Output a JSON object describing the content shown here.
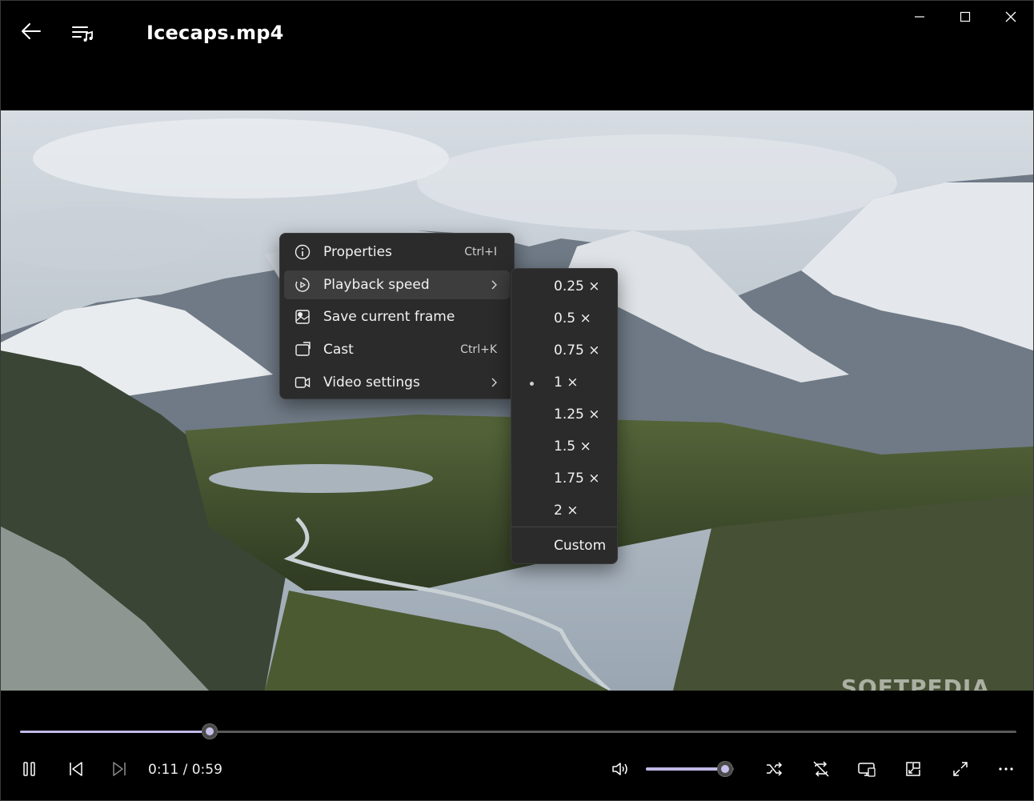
{
  "window": {
    "title": "Icecaps.mp4"
  },
  "titlebar": {
    "back_icon": "back-arrow-icon",
    "playlist_icon": "playlist-icon",
    "minimize_icon": "minimize-icon",
    "maximize_icon": "maximize-icon",
    "close_icon": "close-icon"
  },
  "video": {
    "watermark": "SOFTPEDIA"
  },
  "context_menu": {
    "items": [
      {
        "label": "Properties",
        "shortcut": "Ctrl+I",
        "icon": "info-icon"
      },
      {
        "label": "Playback speed",
        "shortcut": "",
        "icon": "playback-speed-icon",
        "submenu": true
      },
      {
        "label": "Save current frame",
        "shortcut": "",
        "icon": "save-frame-icon"
      },
      {
        "label": "Cast",
        "shortcut": "Ctrl+K",
        "icon": "cast-icon"
      },
      {
        "label": "Video settings",
        "shortcut": "",
        "icon": "video-settings-icon",
        "submenu": true
      }
    ]
  },
  "speed_menu": {
    "options": [
      "0.25 ×",
      "0.5 ×",
      "0.75 ×",
      "1 ×",
      "1.25 ×",
      "1.5 ×",
      "1.75 ×",
      "2 ×"
    ],
    "selected": "1 ×",
    "custom_label": "Custom"
  },
  "playback": {
    "current_time": "0:11",
    "duration": "0:59",
    "time_display": "0:11 / 0:59",
    "progress_fraction": 0.19,
    "volume_fraction": 0.9
  },
  "controls": {
    "icons": [
      "pause-icon",
      "previous-icon",
      "next-icon",
      "volume-icon",
      "shuffle-icon",
      "repeat-off-icon",
      "cast-to-device-icon",
      "mini-player-icon",
      "fullscreen-icon",
      "more-icon"
    ]
  },
  "colors": {
    "accent": "#c1b9e6",
    "menu_bg": "#2b2b2b",
    "window_bg": "#000000"
  }
}
